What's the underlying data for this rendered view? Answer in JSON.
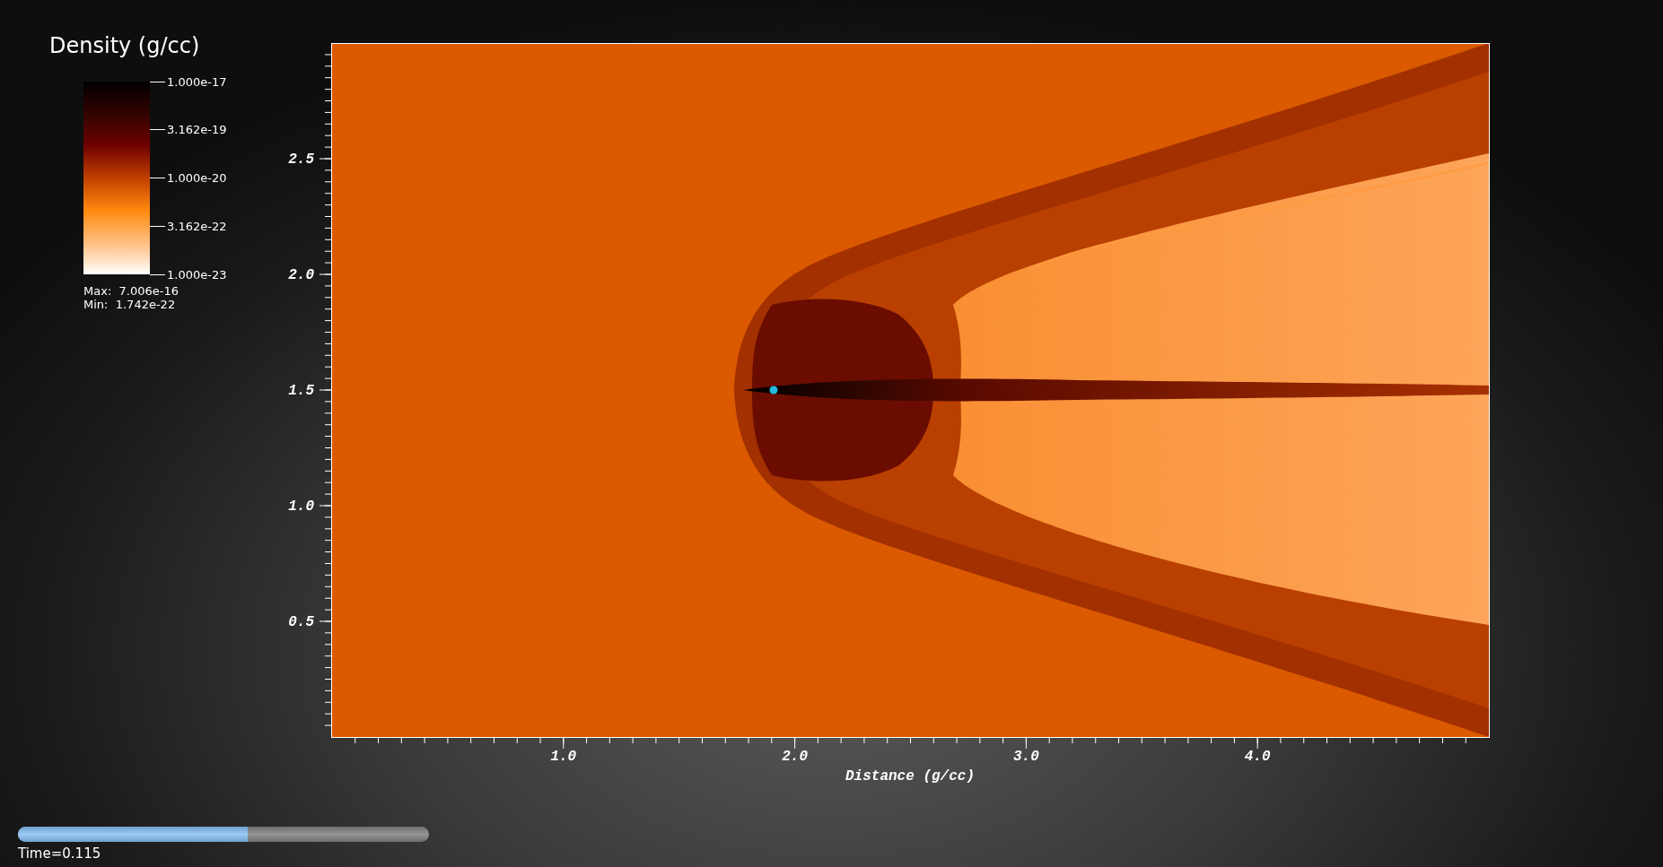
{
  "legend": {
    "title": "Density (g/cc)",
    "labels": [
      "1.000e-17",
      "3.162e-19",
      "1.000e-20",
      "3.162e-22",
      "1.000e-23"
    ],
    "max": "Max:  7.006e-16",
    "min": "Min:  1.742e-22"
  },
  "plot": {
    "x_axis": {
      "title": "Distance (g/cc)",
      "ticks": [
        "1.0",
        "2.0",
        "3.0",
        "4.0"
      ]
    },
    "y_axis": {
      "ticks": [
        "2.5",
        "2.0",
        "1.5",
        "1.0",
        "0.5"
      ]
    }
  },
  "time_slider": {
    "level": 0.56,
    "label": "Time=0.115"
  }
}
